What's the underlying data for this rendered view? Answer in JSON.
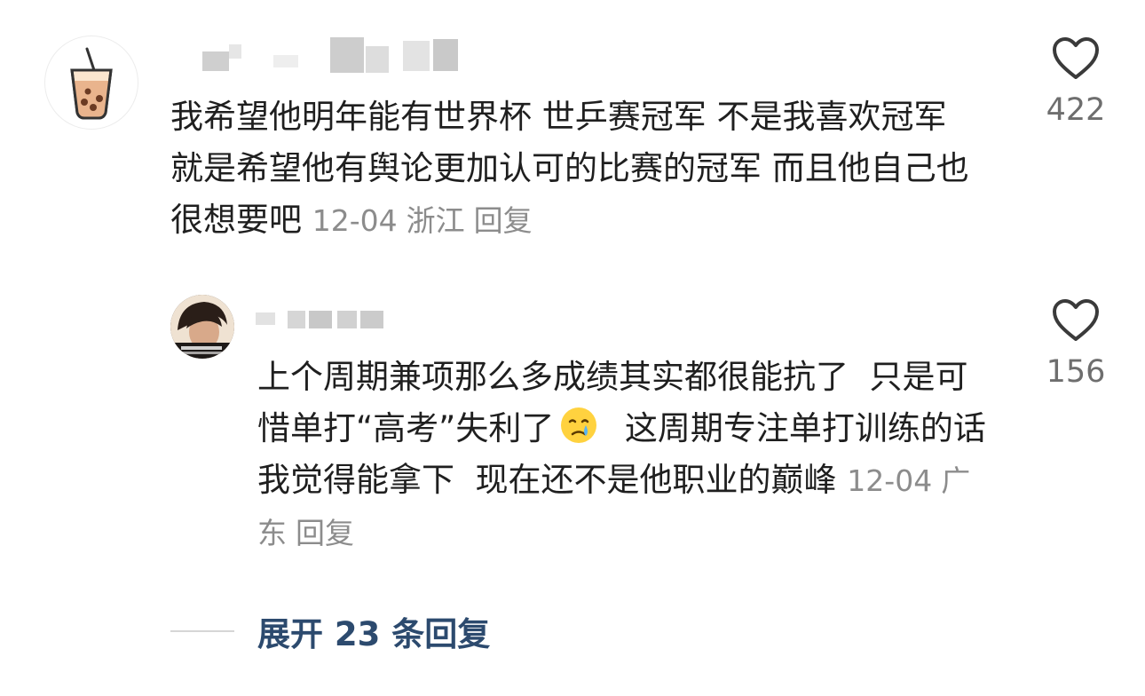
{
  "comments": [
    {
      "text": "我希望他明年能有世界杯 世乒赛冠军 不是我喜欢冠军 就是希望他有舆论更加认可的比赛的冠军 而且他自己也很想要吧",
      "date": "12-04",
      "location": "浙江",
      "reply_label": "回复",
      "likes": "422",
      "avatar_icon": "bubble-tea-icon"
    },
    {
      "text_part1": "上个周期兼项那么多成绩其实都很能抗了  只是可惜单打“高考”失利了",
      "emoji_icon": "crying-face-emoji",
      "text_part2": "  这周期专注单打训练的话 我觉得能拿下  现在还不是他职业的巅峰",
      "date": "12-04",
      "location": "广东",
      "reply_label": "回复",
      "likes": "156",
      "avatar_icon": "person-photo-avatar"
    }
  ],
  "expand_replies_label": "展开 23 条回复",
  "colors": {
    "accent": "#2c4a6e",
    "meta": "#8c8c8c",
    "text": "#1f1f1f"
  }
}
